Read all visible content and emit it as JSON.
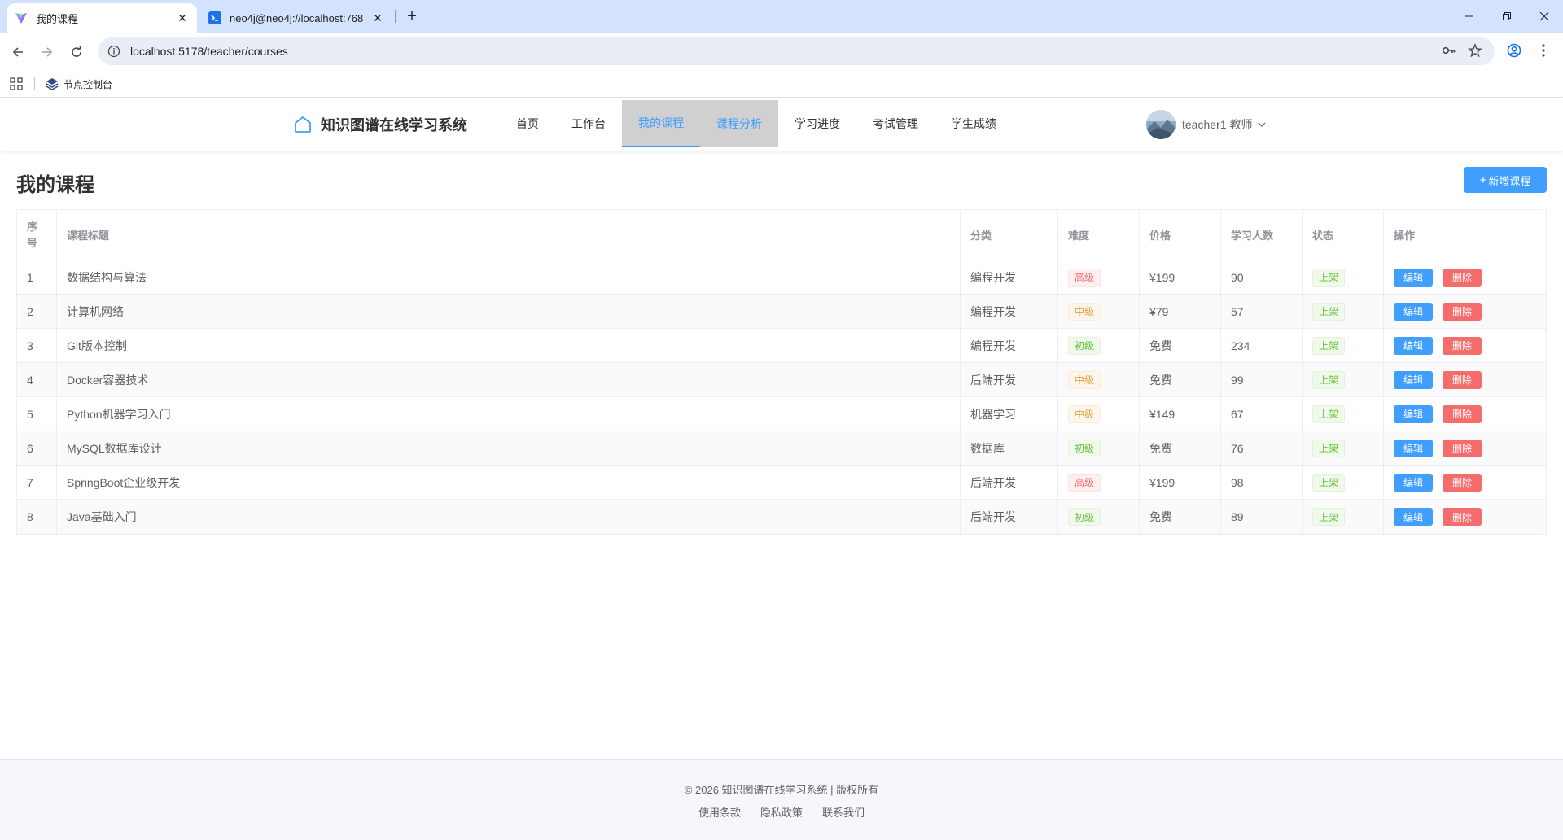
{
  "browser": {
    "tabs": [
      {
        "title": "我的课程",
        "active": true
      },
      {
        "title": "neo4j@neo4j://localhost:768",
        "active": false
      }
    ],
    "url": "localhost:5178/teacher/courses",
    "bookmark": "节点控制台"
  },
  "app": {
    "logo_text": "知识图谱在线学习系统",
    "nav": [
      "首页",
      "工作台",
      "我的课程",
      "课程分析",
      "学习进度",
      "考试管理",
      "学生成绩"
    ],
    "active_nav": "我的课程",
    "user": {
      "name": "teacher1",
      "role": "教师"
    }
  },
  "main": {
    "title": "我的课程",
    "add_button": "新增课程",
    "columns": [
      "序号",
      "课程标题",
      "分类",
      "难度",
      "价格",
      "学习人数",
      "状态",
      "操作"
    ],
    "rows": [
      {
        "idx": "1",
        "title": "数据结构与算法",
        "category": "编程开发",
        "difficulty": "高级",
        "price": "¥199",
        "students": "90",
        "status": "上架"
      },
      {
        "idx": "2",
        "title": "计算机网络",
        "category": "编程开发",
        "difficulty": "中级",
        "price": "¥79",
        "students": "57",
        "status": "上架"
      },
      {
        "idx": "3",
        "title": "Git版本控制",
        "category": "编程开发",
        "difficulty": "初级",
        "price": "免费",
        "students": "234",
        "status": "上架"
      },
      {
        "idx": "4",
        "title": "Docker容器技术",
        "category": "后端开发",
        "difficulty": "中级",
        "price": "免费",
        "students": "99",
        "status": "上架"
      },
      {
        "idx": "5",
        "title": "Python机器学习入门",
        "category": "机器学习",
        "difficulty": "中级",
        "price": "¥149",
        "students": "67",
        "status": "上架"
      },
      {
        "idx": "6",
        "title": "MySQL数据库设计",
        "category": "数据库",
        "difficulty": "初级",
        "price": "免费",
        "students": "76",
        "status": "上架"
      },
      {
        "idx": "7",
        "title": "SpringBoot企业级开发",
        "category": "后端开发",
        "difficulty": "高级",
        "price": "¥199",
        "students": "98",
        "status": "上架"
      },
      {
        "idx": "8",
        "title": "Java基础入门",
        "category": "后端开发",
        "difficulty": "初级",
        "price": "免费",
        "students": "89",
        "status": "上架"
      }
    ],
    "edit_label": "编辑",
    "delete_label": "删除"
  },
  "footer": {
    "copyright": "© 2026 知识图谱在线学习系统 | 版权所有",
    "links": [
      "使用条款",
      "隐私政策",
      "联系我们"
    ]
  },
  "colors": {
    "primary": "#409eff",
    "danger": "#f56c6c",
    "warning": "#e6a23c",
    "success": "#67c23a"
  }
}
